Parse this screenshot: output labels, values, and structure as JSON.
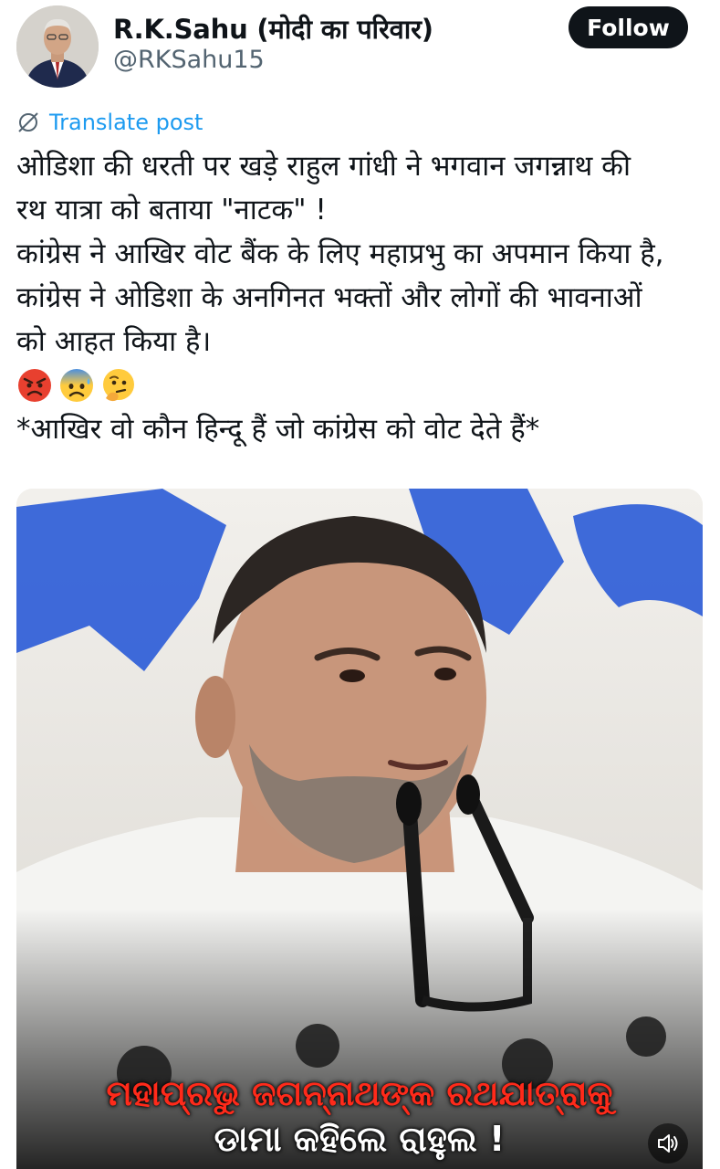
{
  "author": {
    "display_name": "R.K.Sahu (मोदी का परिवार)",
    "handle": "@RKSahu15",
    "avatar_icon": "avatar-photo"
  },
  "follow_label": "Follow",
  "translate": {
    "label": "Translate post",
    "icon": "globe-icon"
  },
  "tweet": {
    "lines": [
      "ओडिशा की धरती पर खड़े राहुल गांधी ने भगवान जगन्नाथ की",
      "रथ यात्रा को बताया \"नाटक\" !",
      "कांग्रेस ने आखिर वोट बैंक के लिए महाप्रभु का अपमान किया है,",
      "कांग्रेस ने ओडिशा के अनगिनत भक्तों और लोगों की भावनाओं",
      "को आहत किया है।"
    ],
    "emojis": [
      "angry-face-emoji",
      "anxious-sweat-face-emoji",
      "thinking-face-emoji"
    ],
    "last_line": "*आखिर वो कौन हिन्दू हैं जो कांग्रेस को वोट देते हैं*"
  },
  "media": {
    "caption_line1": "ମହାପ୍ରଭୁ ଜଗନ୍ନାଥଙ୍କ ରଥଯାତ୍ରାକୁ",
    "caption_line2": "ଡାମା କହିଲେ ରାହୁଲ !",
    "mute_icon": "speaker-icon",
    "accent_color": "#2a5bd7"
  }
}
